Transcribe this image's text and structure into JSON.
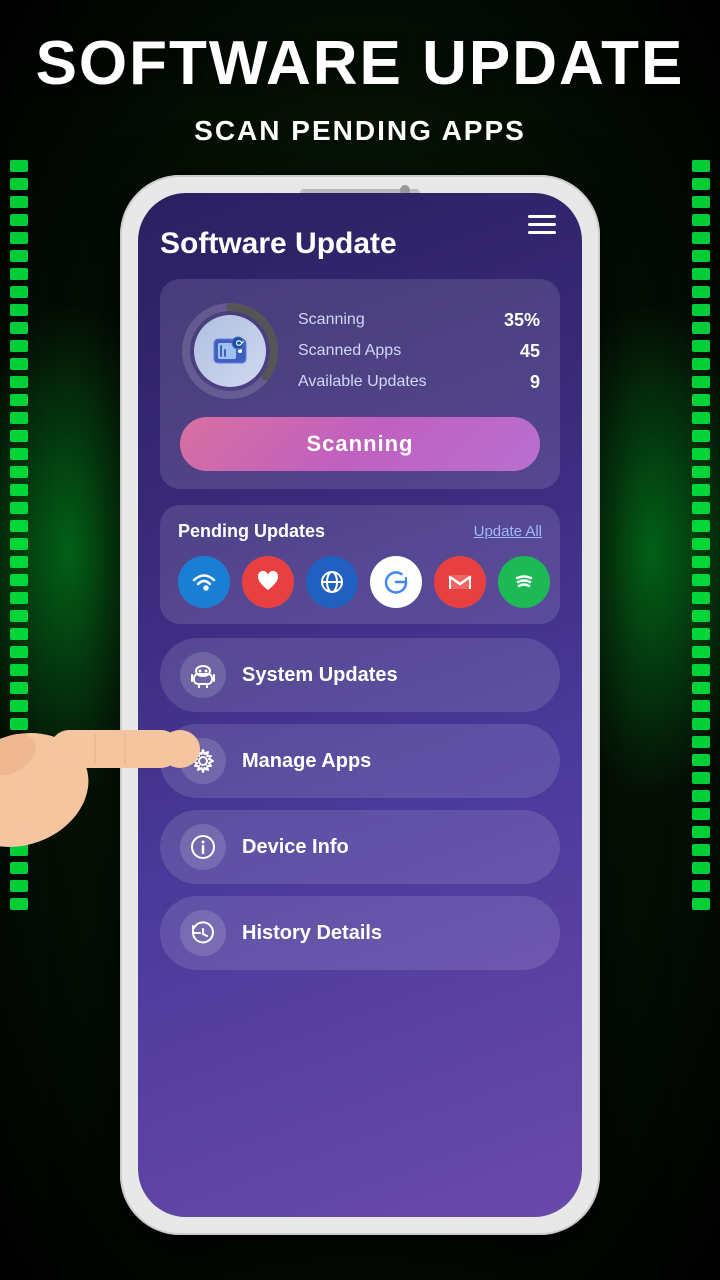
{
  "background": {
    "color": "#0a1a0a"
  },
  "header": {
    "title": "SOFTWARE UPDATE",
    "subtitle": "SCAN PENDING APPS"
  },
  "app": {
    "title": "Software Update",
    "menu_label": "menu"
  },
  "scan_card": {
    "progress_percent": 35,
    "stats": [
      {
        "label": "Scanning",
        "value": "35%"
      },
      {
        "label": "Scanned Apps",
        "value": "45"
      },
      {
        "label": "Available Updates",
        "value": "9"
      }
    ],
    "button_label": "Scanning"
  },
  "pending_updates": {
    "title": "Pending Updates",
    "update_all_label": "Update All",
    "apps": [
      {
        "name": "wifi",
        "icon": "📶",
        "bg": "wifi"
      },
      {
        "name": "heart",
        "icon": "❤️",
        "bg": "heart"
      },
      {
        "name": "globe",
        "icon": "🌐",
        "bg": "globe"
      },
      {
        "name": "google",
        "icon": "G",
        "bg": "google"
      },
      {
        "name": "gmail",
        "icon": "✉",
        "bg": "gmail"
      },
      {
        "name": "spotify",
        "icon": "♪",
        "bg": "spotify"
      }
    ]
  },
  "menu_items": [
    {
      "id": "system-updates",
      "label": "System Updates",
      "icon": "🤖"
    },
    {
      "id": "manage-apps",
      "label": "Manage Apps",
      "icon": "⚙️"
    },
    {
      "id": "device-info",
      "label": "Device Info",
      "icon": "ℹ️"
    },
    {
      "id": "history-details",
      "label": "History Details",
      "icon": "🔄"
    }
  ]
}
